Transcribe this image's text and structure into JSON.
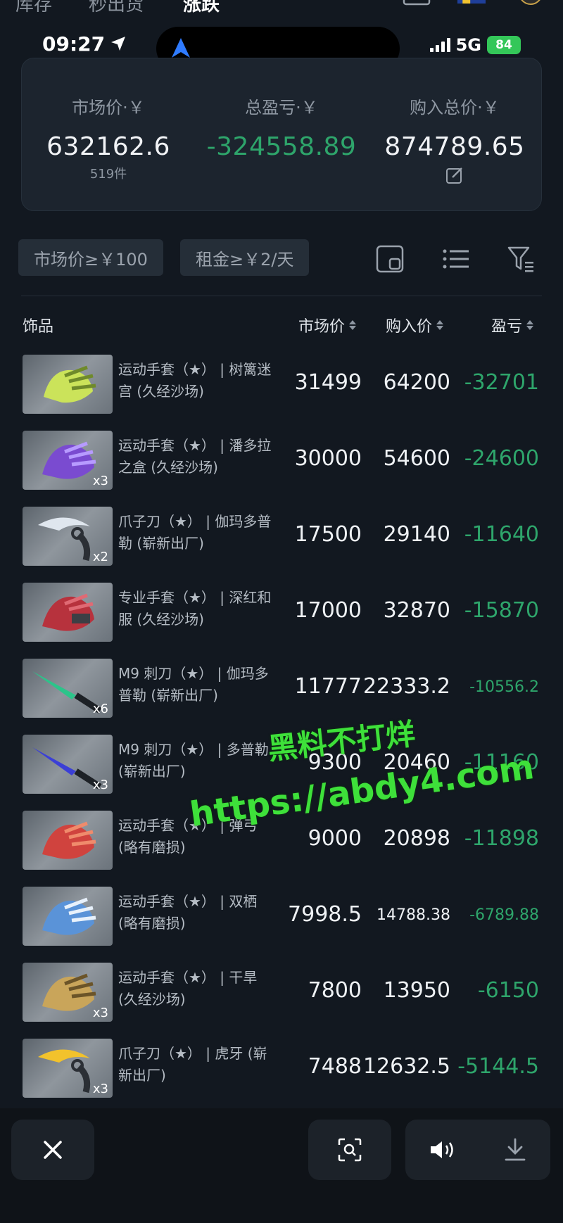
{
  "app_tabs": [
    "库存",
    "秒出货",
    "涨跌"
  ],
  "status": {
    "time": "09:27",
    "network": "5G",
    "battery": "84"
  },
  "summary": {
    "market": {
      "label": "市场价·￥",
      "value": "632162.6",
      "sub": "519件"
    },
    "profit": {
      "label": "总盈亏·￥",
      "value": "-324558.89"
    },
    "cost": {
      "label": "购入总价·￥",
      "value": "874789.65"
    }
  },
  "filters": {
    "chip1": "市场价≥￥100",
    "chip2": "租金≥￥2/天"
  },
  "columns": {
    "item": "饰品",
    "market": "市场价",
    "buy": "购入价",
    "pl": "盈亏"
  },
  "items": [
    {
      "name": "运动手套（★） | 树篱迷宫 (久经沙场)",
      "qty": "",
      "market": "31499",
      "buy": "64200",
      "pl": "-32701"
    },
    {
      "name": "运动手套（★） | 潘多拉之盒 (久经沙场)",
      "qty": "x3",
      "market": "30000",
      "buy": "54600",
      "pl": "-24600"
    },
    {
      "name": "爪子刀（★） | 伽玛多普勒 (崭新出厂)",
      "qty": "x2",
      "market": "17500",
      "buy": "29140",
      "pl": "-11640"
    },
    {
      "name": "专业手套（★） | 深红和服 (久经沙场)",
      "qty": "",
      "market": "17000",
      "buy": "32870",
      "pl": "-15870"
    },
    {
      "name": "M9 刺刀（★） | 伽玛多普勒 (崭新出厂)",
      "qty": "x6",
      "market": "11777",
      "buy": "22333.2",
      "pl": "-10556.2"
    },
    {
      "name": "M9 刺刀（★） | 多普勒 (崭新出厂)",
      "qty": "x3",
      "market": "9300",
      "buy": "20460",
      "pl": "-11160"
    },
    {
      "name": "运动手套（★） | 弹弓 (略有磨损)",
      "qty": "",
      "market": "9000",
      "buy": "20898",
      "pl": "-11898"
    },
    {
      "name": "运动手套（★） | 双栖 (略有磨损)",
      "qty": "",
      "market": "7998.5",
      "buy": "14788.38",
      "pl": "-6789.88"
    },
    {
      "name": "运动手套（★） | 干旱 (久经沙场)",
      "qty": "x3",
      "market": "7800",
      "buy": "13950",
      "pl": "-6150"
    },
    {
      "name": "爪子刀（★） | 虎牙 (崭新出厂)",
      "qty": "x3",
      "market": "7488",
      "buy": "12632.5",
      "pl": "-5144.5"
    }
  ],
  "watermark": {
    "line1": "黑料不打烊",
    "line2": "https://abdy4.com"
  },
  "colors": {
    "negative": "#2ea56b",
    "background": "#121820",
    "card": "#1c242e"
  }
}
